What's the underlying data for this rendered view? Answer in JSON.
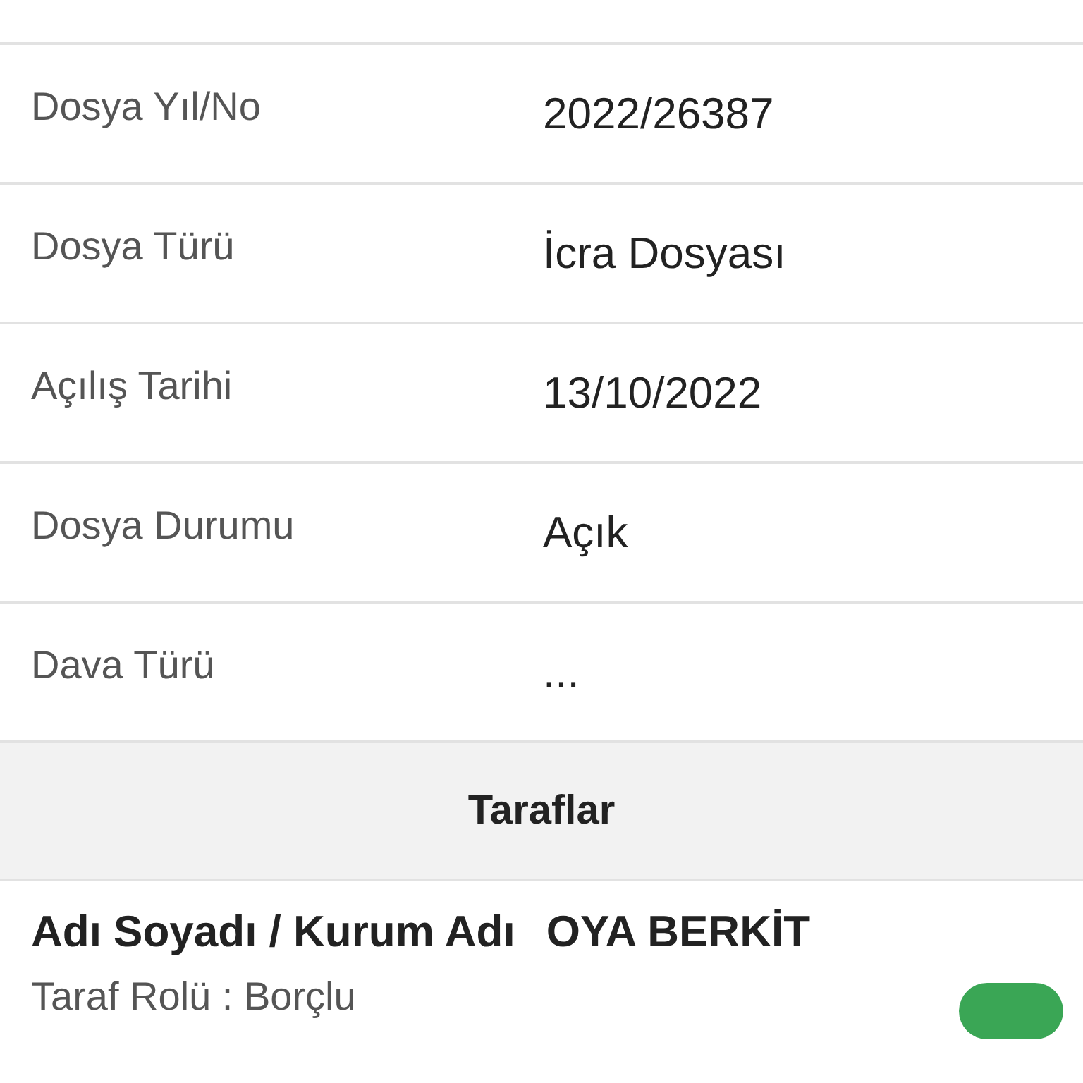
{
  "details": [
    {
      "label": "Dosya Yıl/No",
      "value": "2022/26387"
    },
    {
      "label": "Dosya Türü",
      "value": "İcra Dosyası"
    },
    {
      "label": "Açılış Tarihi",
      "value": "13/10/2022"
    },
    {
      "label": "Dosya Durumu",
      "value": "Açık"
    },
    {
      "label": "Dava Türü",
      "value": "..."
    }
  ],
  "parties_section": {
    "title": "Taraflar",
    "parties": [
      {
        "name_label": "Adı Soyadı / Kurum Adı",
        "name": "OYA BERKİT",
        "role": "Taraf Rolü : Borçlu"
      }
    ]
  }
}
